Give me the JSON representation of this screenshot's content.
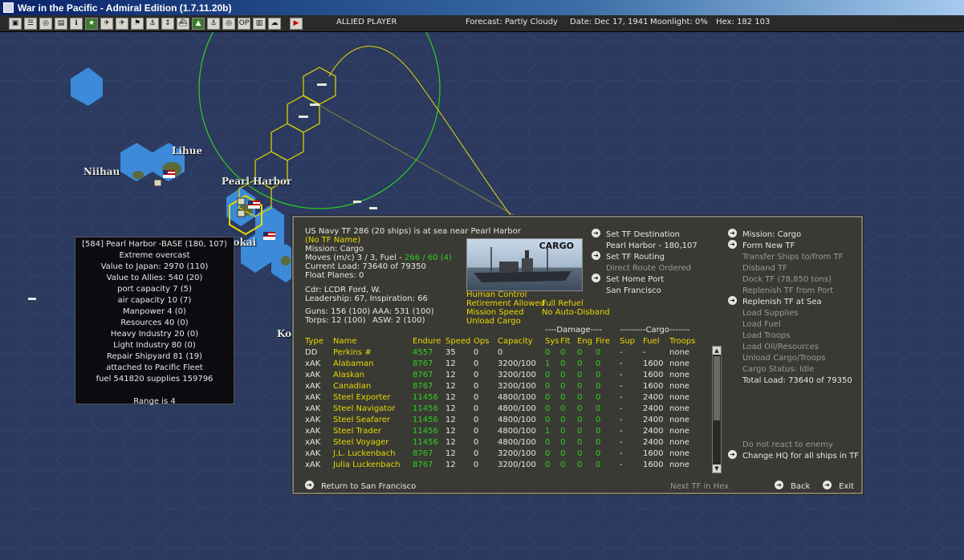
{
  "window": {
    "title": "War in the Pacific - Admiral Edition (1.7.11.20b)"
  },
  "toolbar": {
    "buttons": [
      "▣",
      "☰",
      "◎",
      "▤",
      "ℹ",
      "★",
      "✈",
      "✈",
      "⚑",
      "⚓",
      "↕",
      "⛴",
      "▲",
      "⚓",
      "◎",
      "OP",
      "▥",
      "☁",
      "▶"
    ],
    "player": "ALLIED PLAYER",
    "forecast": "Forecast: Partly Cloudy",
    "date": "Date: Dec 17, 1941",
    "moonlight": "Moonlight: 0%",
    "hex": "Hex: 182 103"
  },
  "map": {
    "labels": {
      "lihue": "Lihue",
      "niihau": "Niihau",
      "pearl_harbor": "Pearl Harbor",
      "molokai": "lokai",
      "kona": "Ko"
    }
  },
  "base_popup": {
    "lines": [
      "[584] Pearl Harbor  -BASE (180, 107)",
      "Extreme overcast",
      "Value to Japan: 2970 (110)",
      "Value to Allies: 540 (20)",
      "port capacity 7 (5)",
      "air capacity 10 (7)",
      "Manpower  4 (0)",
      "Resources  40 (0)",
      "Heavy Industry  20 (0)",
      "Light Industry  80 (0)",
      "Repair Shipyard  81 (19)",
      "attached to Pacific Fleet",
      "fuel 541820  supplies 159796"
    ],
    "range": "Range is 4"
  },
  "tf": {
    "header": "US Navy TF 286 (20 ships) is at sea near Pearl Harbor",
    "name": "(No TF Name)",
    "mission": "Mission: Cargo",
    "moves_prefix": "Moves (m/c)  3 / 3, Fuel - ",
    "moves_fuel": "266 / 60 (4)",
    "current_load": "Current Load:  73640 of 79350",
    "float_planes": "Float Planes:  0",
    "cdr": "Cdr: LCDR  Ford, W.",
    "leadership": "Leadership: 67, Inspiration: 66",
    "guns": "Guns: 156 (100)",
    "aaa": "AAA: 531 (100)",
    "torps": "Torps: 12 (100)",
    "asw": "ASW: 2 (100)",
    "image_caption": "CARGO",
    "options": {
      "human_control": "Human Control",
      "retirement": "Retirement Allowed",
      "full_refuel": "Full Refuel",
      "mission_speed": "Mission Speed",
      "no_auto_disband": "No Auto-Disband",
      "unload_cargo": "Unload Cargo"
    },
    "middle_actions": {
      "set_destination": "Set TF Destination",
      "destination_value": "Pearl Harbor - 180,107",
      "set_routing": "Set TF Routing",
      "routing_value": "Direct Route Ordered",
      "set_home": "Set Home Port",
      "home_value": "San Francisco"
    },
    "right_actions": {
      "mission": "Mission: Cargo",
      "form_new": "Form New TF",
      "transfer": "Transfer Ships to/from TF",
      "disband": "Disband TF",
      "dock": "Dock TF (78,850 tons)",
      "replenish_port": "Replenish TF from Port",
      "replenish_sea": "Replenish TF at Sea",
      "load_supplies": "Load Supplies",
      "load_fuel": "Load Fuel",
      "load_troops": "Load Troops",
      "load_oil": "Load Oil/Resources",
      "unload": "Unload Cargo/Troops",
      "cargo_status": "Cargo Status: Idle",
      "total_load": "Total Load: 73640 of 79350",
      "no_react": "Do not react to enemy",
      "change_hq": "Change HQ for all ships in TF"
    },
    "group_headers": {
      "damage": "----Damage----",
      "cargo": "---------Cargo-------"
    },
    "columns": [
      "Type",
      "Name",
      "Endure",
      "Speed",
      "Ops",
      "Capacity",
      "Sys",
      "Flt",
      "Eng",
      "Fire",
      "Sup",
      "Fuel",
      "Troops"
    ],
    "ships": [
      [
        "DD",
        "Perkins #",
        "4557",
        "35",
        "0",
        "0",
        "0",
        "0",
        "0",
        "0",
        "-",
        "-",
        "none"
      ],
      [
        "xAK",
        "Alabaman",
        "8767",
        "12",
        "0",
        "3200/100",
        "1",
        "0",
        "0",
        "0",
        "-",
        "1600",
        "none"
      ],
      [
        "xAK",
        "Alaskan",
        "8767",
        "12",
        "0",
        "3200/100",
        "0",
        "0",
        "0",
        "0",
        "-",
        "1600",
        "none"
      ],
      [
        "xAK",
        "Canadian",
        "8767",
        "12",
        "0",
        "3200/100",
        "0",
        "0",
        "0",
        "0",
        "-",
        "1600",
        "none"
      ],
      [
        "xAK",
        "Steel Exporter",
        "11456",
        "12",
        "0",
        "4800/100",
        "0",
        "0",
        "0",
        "0",
        "-",
        "2400",
        "none"
      ],
      [
        "xAK",
        "Steel Navigator",
        "11456",
        "12",
        "0",
        "4800/100",
        "0",
        "0",
        "0",
        "0",
        "-",
        "2400",
        "none"
      ],
      [
        "xAK",
        "Steel Seafarer",
        "11456",
        "12",
        "0",
        "4800/100",
        "0",
        "0",
        "0",
        "0",
        "-",
        "2400",
        "none"
      ],
      [
        "xAK",
        "Steel Trader",
        "11456",
        "12",
        "0",
        "4800/100",
        "1",
        "0",
        "0",
        "0",
        "-",
        "2400",
        "none"
      ],
      [
        "xAK",
        "Steel Voyager",
        "11456",
        "12",
        "0",
        "4800/100",
        "0",
        "0",
        "0",
        "0",
        "-",
        "2400",
        "none"
      ],
      [
        "xAK",
        "J.L. Luckenbach",
        "8767",
        "12",
        "0",
        "3200/100",
        "0",
        "0",
        "0",
        "0",
        "-",
        "1600",
        "none"
      ],
      [
        "xAK",
        "Julia Luckenbach",
        "8767",
        "12",
        "0",
        "3200/100",
        "0",
        "0",
        "0",
        "0",
        "-",
        "1600",
        "none"
      ]
    ],
    "footer": {
      "return": "Return to San Francisco",
      "next": "Next TF in Hex",
      "back": "Back",
      "exit": "Exit"
    }
  },
  "colors": {
    "sea": "#2b3a5e",
    "land": "#3c8ad8",
    "tf_panel": "#3a3a34",
    "yellow": "#e8d800",
    "green": "#2ed020"
  }
}
